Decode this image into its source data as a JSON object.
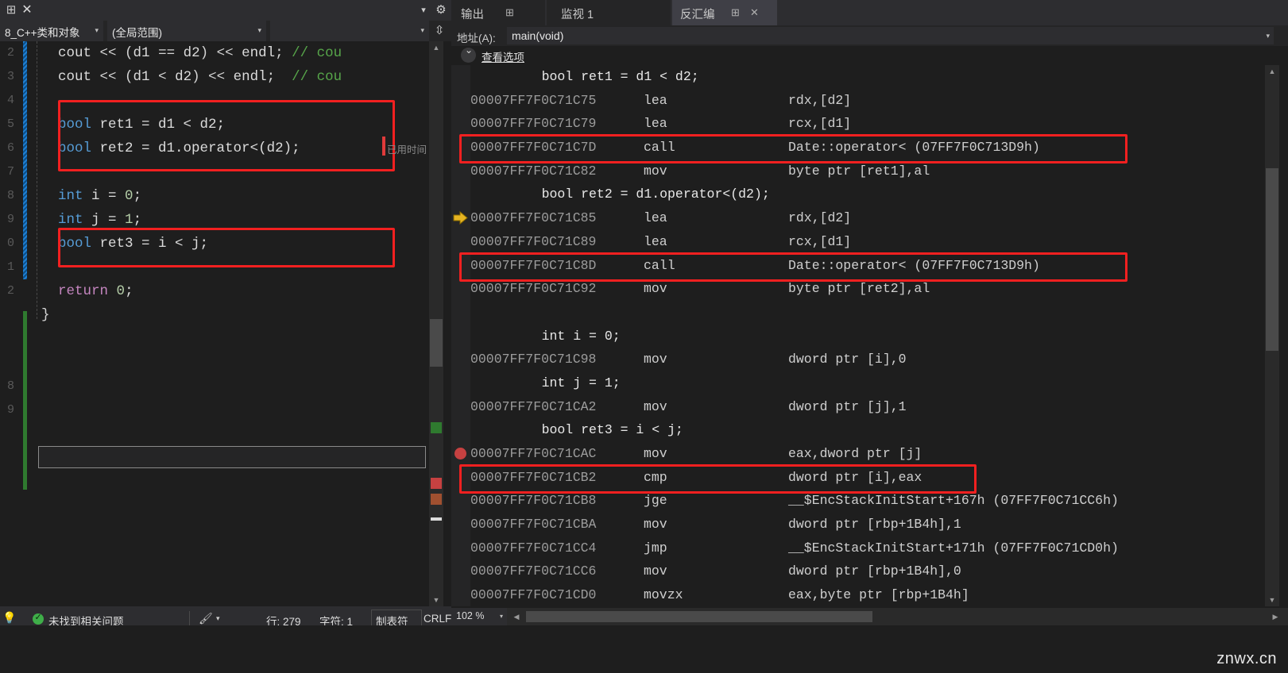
{
  "left_pane": {
    "titlebar": {
      "pin_icon": "pin-icon",
      "close_icon": "close-icon",
      "dropdown_icon": "chevron-down-icon",
      "gear_icon": "gear-icon"
    },
    "nav": {
      "project_combo": "8_C++类和对象",
      "scope_combo": "(全局范围)",
      "member_combo": "",
      "split_icon": "split-view-icon"
    },
    "line_numbers": [
      "2",
      "3",
      "4",
      "5",
      "6",
      "7",
      "8",
      "9",
      "0",
      "1",
      "2",
      "",
      "",
      "",
      "8",
      "9"
    ],
    "code_lines": [
      {
        "indent": 2,
        "tokens": [
          {
            "t": "cout",
            "c": "id"
          },
          {
            "t": " << (",
            "c": "pl"
          },
          {
            "t": "d1",
            "c": "id"
          },
          {
            "t": " == ",
            "c": "pl"
          },
          {
            "t": "d2",
            "c": "id"
          },
          {
            "t": ") << ",
            "c": "pl"
          },
          {
            "t": "endl",
            "c": "id"
          },
          {
            "t": "; ",
            "c": "pl"
          },
          {
            "t": "// cou",
            "c": "cmt"
          }
        ]
      },
      {
        "indent": 2,
        "tokens": [
          {
            "t": "cout",
            "c": "id"
          },
          {
            "t": " << (",
            "c": "pl"
          },
          {
            "t": "d1",
            "c": "id"
          },
          {
            "t": " < ",
            "c": "pl"
          },
          {
            "t": "d2",
            "c": "id"
          },
          {
            "t": ") << ",
            "c": "pl"
          },
          {
            "t": "endl",
            "c": "id"
          },
          {
            "t": ";  ",
            "c": "pl"
          },
          {
            "t": "// cou",
            "c": "cmt"
          }
        ]
      },
      {
        "indent": 2,
        "tokens": []
      },
      {
        "indent": 2,
        "tokens": [
          {
            "t": "bool",
            "c": "kw"
          },
          {
            "t": " ret1 = d1 < d2;",
            "c": "id"
          }
        ]
      },
      {
        "indent": 2,
        "tokens": [
          {
            "t": "bool",
            "c": "kw"
          },
          {
            "t": " ret2 = d1.operator<(d2);",
            "c": "id"
          }
        ]
      },
      {
        "indent": 2,
        "tokens": []
      },
      {
        "indent": 2,
        "tokens": [
          {
            "t": "int",
            "c": "kw"
          },
          {
            "t": " i = ",
            "c": "id"
          },
          {
            "t": "0",
            "c": "num"
          },
          {
            "t": ";",
            "c": "id"
          }
        ]
      },
      {
        "indent": 2,
        "tokens": [
          {
            "t": "int",
            "c": "kw"
          },
          {
            "t": " j = ",
            "c": "id"
          },
          {
            "t": "1",
            "c": "num"
          },
          {
            "t": ";",
            "c": "id"
          }
        ]
      },
      {
        "indent": 2,
        "tokens": [
          {
            "t": "bool",
            "c": "kw"
          },
          {
            "t": " ret3 = i < j;",
            "c": "id"
          }
        ]
      },
      {
        "indent": 2,
        "tokens": []
      },
      {
        "indent": 2,
        "tokens": [
          {
            "t": "return",
            "c": "kw2"
          },
          {
            "t": " ",
            "c": "pl"
          },
          {
            "t": "0",
            "c": "num"
          },
          {
            "t": ";",
            "c": "id"
          }
        ]
      },
      {
        "indent": 0,
        "tokens": [
          {
            "t": "}",
            "c": "pl"
          }
        ]
      }
    ],
    "elapsed_tooltip": "已用时间",
    "status": {
      "lightbulb_icon": "lightbulb-icon",
      "ok_icon": "check-circle-icon",
      "problems_text": "未找到相关问题",
      "brush_icon": "brush-icon",
      "brush_arrow_icon": "chevron-down-icon",
      "line_label": "行: 279",
      "char_label": "字符: 1",
      "tab_label": "制表符",
      "eol_label": "CRLF"
    },
    "scrollbar": {
      "up_icon": "scroll-up-icon",
      "down_icon": "scroll-down-icon"
    }
  },
  "right_pane": {
    "tabs": [
      {
        "label": "输出",
        "icon": "pin-icon",
        "active": false
      },
      {
        "label": "监视 1",
        "icon": "",
        "active": false
      },
      {
        "label": "反汇编",
        "icon": "pin-icon",
        "close_icon": "close-icon",
        "active": true
      }
    ],
    "address_bar": {
      "label": "地址(A):",
      "value": "main(void)",
      "arrow_icon": "chevron-down-icon"
    },
    "view_options": {
      "label": "查看选项",
      "expander_icon": "chevron-down-icon"
    },
    "disassembly": [
      {
        "kind": "src",
        "text": "    bool ret1 = d1 < d2;"
      },
      {
        "kind": "asm",
        "addr": "00007FF7F0C71C75",
        "op": "lea",
        "arg": "rdx,[d2]"
      },
      {
        "kind": "asm",
        "addr": "00007FF7F0C71C79",
        "op": "lea",
        "arg": "rcx,[d1]"
      },
      {
        "kind": "asm",
        "addr": "00007FF7F0C71C7D",
        "op": "call",
        "arg": "Date::operator< (07FF7F0C713D9h)",
        "highlight": true
      },
      {
        "kind": "asm",
        "addr": "00007FF7F0C71C82",
        "op": "mov",
        "arg": "byte ptr [ret1],al"
      },
      {
        "kind": "src",
        "text": "    bool ret2 = d1.operator<(d2);"
      },
      {
        "kind": "asm",
        "addr": "00007FF7F0C71C85",
        "op": "lea",
        "arg": "rdx,[d2]",
        "marker": "instruction-pointer"
      },
      {
        "kind": "asm",
        "addr": "00007FF7F0C71C89",
        "op": "lea",
        "arg": "rcx,[d1]"
      },
      {
        "kind": "asm",
        "addr": "00007FF7F0C71C8D",
        "op": "call",
        "arg": "Date::operator< (07FF7F0C713D9h)",
        "highlight": true
      },
      {
        "kind": "asm",
        "addr": "00007FF7F0C71C92",
        "op": "mov",
        "arg": "byte ptr [ret2],al"
      },
      {
        "kind": "blank",
        "text": ""
      },
      {
        "kind": "src",
        "text": "    int i = 0;"
      },
      {
        "kind": "asm",
        "addr": "00007FF7F0C71C98",
        "op": "mov",
        "arg": "dword ptr [i],0"
      },
      {
        "kind": "src",
        "text": "    int j = 1;"
      },
      {
        "kind": "asm",
        "addr": "00007FF7F0C71CA2",
        "op": "mov",
        "arg": "dword ptr [j],1"
      },
      {
        "kind": "src",
        "text": "    bool ret3 = i < j;"
      },
      {
        "kind": "asm",
        "addr": "00007FF7F0C71CAC",
        "op": "mov",
        "arg": "eax,dword ptr [j]",
        "marker": "breakpoint"
      },
      {
        "kind": "asm",
        "addr": "00007FF7F0C71CB2",
        "op": "cmp",
        "arg": "dword ptr [i],eax",
        "highlight": true
      },
      {
        "kind": "asm",
        "addr": "00007FF7F0C71CB8",
        "op": "jge",
        "arg": "__$EncStackInitStart+167h (07FF7F0C71CC6h)"
      },
      {
        "kind": "asm",
        "addr": "00007FF7F0C71CBA",
        "op": "mov",
        "arg": "dword ptr [rbp+1B4h],1"
      },
      {
        "kind": "asm",
        "addr": "00007FF7F0C71CC4",
        "op": "jmp",
        "arg": "__$EncStackInitStart+171h (07FF7F0C71CD0h)"
      },
      {
        "kind": "asm",
        "addr": "00007FF7F0C71CC6",
        "op": "mov",
        "arg": "dword ptr [rbp+1B4h],0"
      },
      {
        "kind": "asm",
        "addr": "00007FF7F0C71CD0",
        "op": "movzx",
        "arg": "eax,byte ptr [rbp+1B4h]"
      }
    ],
    "zoom_level": "102 %",
    "scrollbar": {
      "up_icon": "scroll-up-icon",
      "down_icon": "scroll-down-icon",
      "left_icon": "scroll-left-icon",
      "right_icon": "scroll-right-icon"
    }
  },
  "watermark": "znwx.cn",
  "colors": {
    "accent": "#6a5acd",
    "highlight_box": "#f22020",
    "breakpoint": "#c64141",
    "ip_arrow": "#e6b422"
  }
}
